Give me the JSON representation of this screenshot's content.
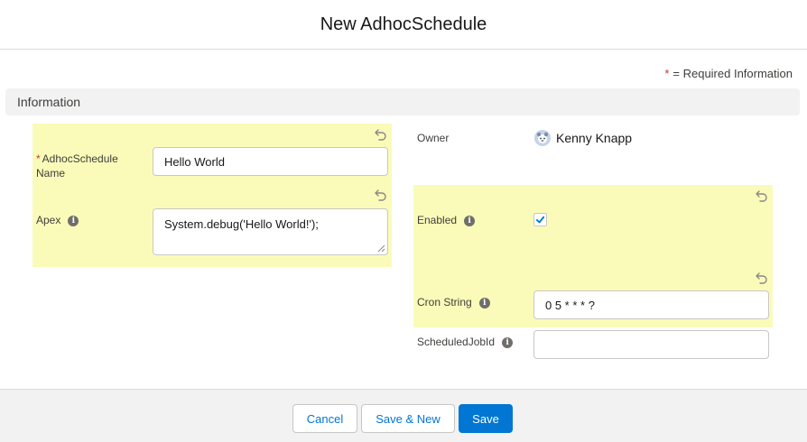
{
  "modal": {
    "title": "New AdhocSchedule"
  },
  "required_note": {
    "star": "*",
    "text": "= Required Information"
  },
  "section": {
    "title": "Information"
  },
  "fields": {
    "name": {
      "star": "*",
      "label_line1": "AdhocSchedule",
      "label_line2": "Name",
      "value": "Hello World"
    },
    "apex": {
      "label": "Apex",
      "value": "System.debug('Hello World!');"
    },
    "owner": {
      "label": "Owner",
      "value": "Kenny Knapp"
    },
    "enabled": {
      "label": "Enabled",
      "checked": true
    },
    "cron": {
      "label": "Cron String",
      "value": "0 5 * * * ?"
    },
    "job_id": {
      "label": "ScheduledJobId",
      "value": ""
    }
  },
  "buttons": {
    "cancel": "Cancel",
    "save_new": "Save & New",
    "save": "Save"
  },
  "colors": {
    "highlight": "#fafbb8",
    "brand": "#0176d3",
    "required": "#c23934"
  }
}
